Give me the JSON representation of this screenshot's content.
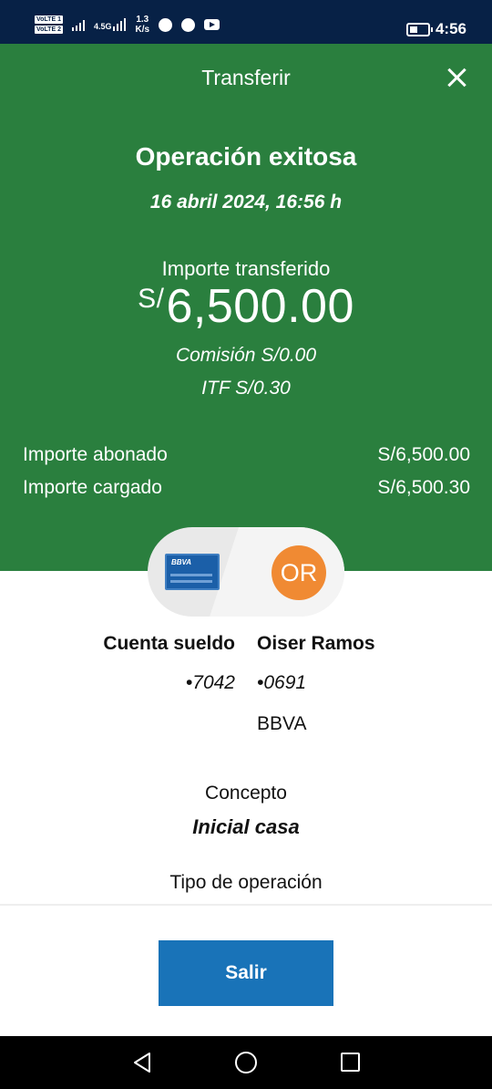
{
  "status_bar": {
    "volte_1": "VoLTE 1",
    "volte_2": "VoLTE 2",
    "network": "4.5G",
    "speed_value": "1.3",
    "speed_unit": "K/s",
    "icons": [
      "signal-icon",
      "signal-icon",
      "chat-icon",
      "whatsapp-icon",
      "youtube-icon",
      "battery-icon"
    ],
    "time": "4:56"
  },
  "header": {
    "title": "Transferir",
    "close_icon": "close-icon"
  },
  "result": {
    "title": "Operación exitosa",
    "date": "16 abril 2024, 16:56 h",
    "amount_label": "Importe transferido",
    "currency": "S/",
    "amount": "6,500.00",
    "commission": "Comisión  S/0.00",
    "itf": "ITF  S/0.30"
  },
  "summary": {
    "credited_label": "Importe abonado",
    "credited_value": "S/6,500.00",
    "charged_label": "Importe cargado",
    "charged_value": "S/6,500.30"
  },
  "accounts": {
    "card_brand": "BBVA",
    "avatar_initials": "OR",
    "origin_name": "Cuenta sueldo",
    "origin_number": "•7042",
    "destination_name": "Oiser Ramos",
    "destination_number": "•0691",
    "destination_bank": "BBVA"
  },
  "details": {
    "concept_label": "Concepto",
    "concept_value": "Inicial casa",
    "operation_type_label": "Tipo de operación"
  },
  "actions": {
    "exit_label": "Salir"
  },
  "nav": {
    "icons": [
      "back-icon",
      "home-icon",
      "recents-icon"
    ]
  },
  "colors": {
    "success_green": "#2a7f3e",
    "status_bar": "#072146",
    "primary_button": "#1973b8",
    "avatar": "#f08a33"
  }
}
